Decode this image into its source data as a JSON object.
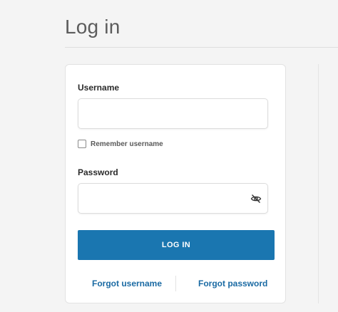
{
  "page": {
    "title": "Log in"
  },
  "form": {
    "username_label": "Username",
    "username_value": "",
    "remember_label": "Remember username",
    "remember_checked": false,
    "password_label": "Password",
    "password_value": "",
    "login_button_label": "LOG IN",
    "forgot_username_label": "Forgot username",
    "forgot_password_label": "Forgot password"
  },
  "icons": {
    "password_toggle": "eye-slash-icon"
  },
  "colors": {
    "background": "#f4f4f4",
    "card": "#ffffff",
    "primary_button": "#1a76b0",
    "link": "#1a6aa3",
    "title_text": "#5c5c5c"
  }
}
